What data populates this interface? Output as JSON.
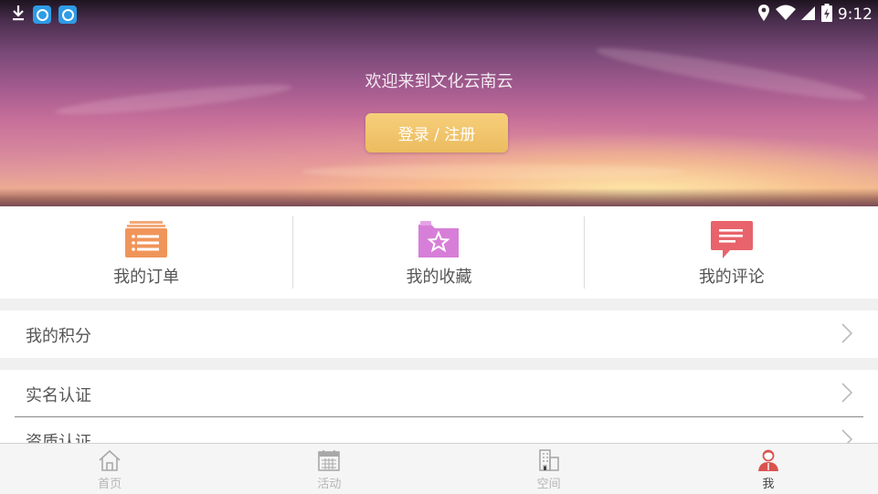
{
  "status_bar": {
    "time": "9:12",
    "icons": [
      "download-icon",
      "app-icon",
      "app-icon",
      "location-icon",
      "wifi-icon",
      "signal-icon",
      "battery-icon"
    ]
  },
  "hero": {
    "welcome_text": "欢迎来到文化云南云",
    "login_label": "登录 / 注册"
  },
  "quick_actions": [
    {
      "label": "我的订单",
      "icon": "order-list-icon",
      "color": "#f0955a"
    },
    {
      "label": "我的收藏",
      "icon": "star-folder-icon",
      "color": "#d77fd8"
    },
    {
      "label": "我的评论",
      "icon": "comment-icon",
      "color": "#e8636b"
    }
  ],
  "menu": [
    {
      "label": "我的积分"
    },
    {
      "label": "实名认证"
    },
    {
      "label": "资质认证"
    }
  ],
  "tabs": [
    {
      "label": "首页",
      "icon": "home-icon"
    },
    {
      "label": "活动",
      "icon": "calendar-icon"
    },
    {
      "label": "空间",
      "icon": "building-icon"
    },
    {
      "label": "我",
      "icon": "user-icon",
      "active": true
    }
  ],
  "colors": {
    "login_button": "#f3c66f",
    "page_background": "#f0f0f0",
    "tab_active": "#d9534f"
  }
}
